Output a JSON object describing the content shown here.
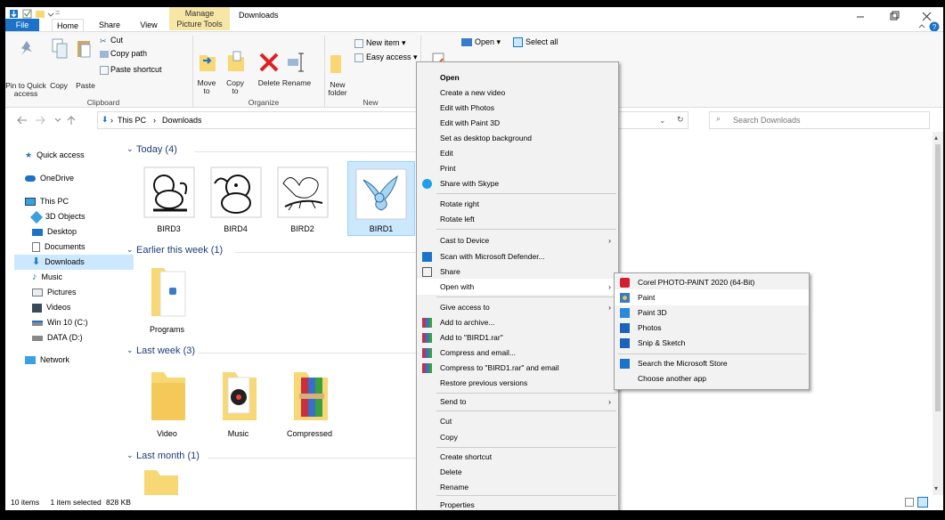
{
  "window": {
    "title": "Downloads",
    "manage_tab": "Manage",
    "picture_tools": "Picture Tools",
    "qat_extra": "="
  },
  "tabs": [
    "File",
    "Home",
    "Share",
    "View"
  ],
  "ribbon": {
    "clipboard": {
      "pin": "Pin to Quick access",
      "copy": "Copy",
      "paste": "Paste",
      "cut": "Cut",
      "copy_path": "Copy path",
      "paste_shortcut": "Paste shortcut",
      "label": "Clipboard"
    },
    "organize": {
      "move_to": "Move to",
      "copy_to": "Copy to",
      "delete": "Delete",
      "rename": "Rename",
      "label": "Organize"
    },
    "new": {
      "new_folder": "New folder",
      "new_item": "New item",
      "easy_access": "Easy access",
      "label": "New"
    },
    "open": {
      "open": "Open",
      "select_all": "Select all"
    }
  },
  "address": {
    "crumbs": [
      "This PC",
      "Downloads"
    ],
    "search_placeholder": "Search Downloads"
  },
  "sidebar": [
    {
      "label": "Quick access",
      "icon": "star-icon"
    },
    {
      "label": "OneDrive",
      "icon": "cloud-icon"
    },
    {
      "label": "This PC",
      "icon": "computer-icon"
    },
    {
      "label": "3D Objects",
      "icon": "cube-icon"
    },
    {
      "label": "Desktop",
      "icon": "desktop-icon"
    },
    {
      "label": "Documents",
      "icon": "document-icon"
    },
    {
      "label": "Downloads",
      "icon": "download-icon"
    },
    {
      "label": "Music",
      "icon": "music-icon"
    },
    {
      "label": "Pictures",
      "icon": "pictures-icon"
    },
    {
      "label": "Videos",
      "icon": "videos-icon"
    },
    {
      "label": "Win 10  (C:)",
      "icon": "drive-icon"
    },
    {
      "label": "DATA (D:)",
      "icon": "drive-icon"
    },
    {
      "label": "Network",
      "icon": "network-icon"
    }
  ],
  "groups": [
    {
      "header": "Today (4)",
      "items": [
        "BIRD3",
        "BIRD4",
        "BIRD2",
        "BIRD1"
      ]
    },
    {
      "header": "Earlier this week (1)",
      "items": [
        "Programs"
      ]
    },
    {
      "header": "Last week (3)",
      "items": [
        "Video",
        "Music",
        "Compressed"
      ]
    },
    {
      "header": "Last month (1)",
      "items": []
    }
  ],
  "status": {
    "count": "10 items",
    "selected": "1 item selected",
    "size": "828 KB"
  },
  "context_menu": [
    "Open",
    "Create a new video",
    "Edit with Photos",
    "Edit with Paint 3D",
    "Set as desktop background",
    "Edit",
    "Print",
    "Share with Skype",
    "Rotate right",
    "Rotate left",
    "Cast to Device",
    "Scan with Microsoft Defender...",
    "Share",
    "Open with",
    "Give access to",
    "Add to archive...",
    "Add to \"BIRD1.rar\"",
    "Compress and email...",
    "Compress to \"BIRD1.rar\" and email",
    "Restore previous versions",
    "Send to",
    "Cut",
    "Copy",
    "Create shortcut",
    "Delete",
    "Rename",
    "Properties"
  ],
  "open_with_menu": [
    "Corel PHOTO-PAINT 2020 (64-Bit)",
    "Paint",
    "Paint 3D",
    "Photos",
    "Snip & Sketch",
    "Search the Microsoft Store",
    "Choose another app"
  ],
  "colors": {
    "file_tab": "#1a73c8",
    "manage_tab": "#f6e7a6",
    "selection": "#cce8ff",
    "folder": "#f8d775"
  }
}
